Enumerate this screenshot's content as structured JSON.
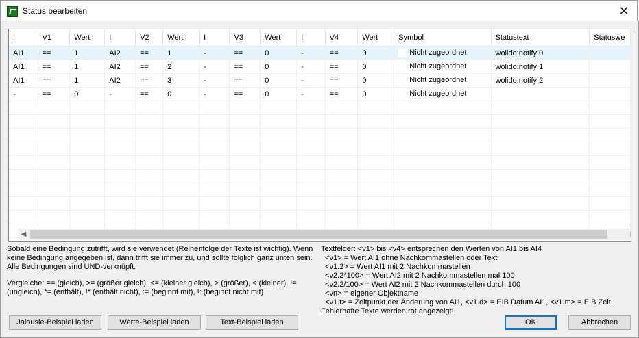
{
  "window": {
    "title": "Status bearbeiten",
    "close": "✕"
  },
  "grid": {
    "columns": [
      "I",
      "V1",
      "Wert",
      "I",
      "V2",
      "Wert",
      "I",
      "V3",
      "Wert",
      "I",
      "V4",
      "Wert",
      "Symbol",
      "Statustext",
      "Statuswe"
    ],
    "rows": [
      [
        "AI1",
        "==",
        "1",
        "AI2",
        "==",
        "1",
        "-",
        "==",
        "0",
        "-",
        "==",
        "0",
        "Nicht zugeordnet",
        "wolido:notify:0",
        ""
      ],
      [
        "AI1",
        "==",
        "1",
        "AI2",
        "==",
        "2",
        "-",
        "==",
        "0",
        "-",
        "==",
        "0",
        "Nicht zugeordnet",
        "wolido:notify:1",
        ""
      ],
      [
        "AI1",
        "==",
        "1",
        "AI2",
        "==",
        "3",
        "-",
        "==",
        "0",
        "-",
        "==",
        "0",
        "Nicht zugeordnet",
        "wolido:notify:2",
        ""
      ],
      [
        "-",
        "==",
        "0",
        "-",
        "==",
        "0",
        "-",
        "==",
        "0",
        "-",
        "==",
        "0",
        "Nicht zugeordnet",
        "",
        ""
      ]
    ],
    "selected_row": 0,
    "empty_rows": 10
  },
  "help_left": {
    "p1": "Sobald eine Bedingung zutrifft, wird sie verwendet (Reihenfolge der Texte ist wichtig). Wenn\nkeine Bedingung angegeben ist, dann trifft sie immer zu, und sollte folglich ganz unten sein.\nAlle Bedingungen sind UND-verknüpft.",
    "p2": "Vergleiche: == (gleich), >= (größer gleich), <= (kleiner gleich), > (größer), < (kleiner), !=\n(ungleich), *= (enthält), !* (enthält nicht), := (beginnt mit), !: (beginnt nicht mit)"
  },
  "help_right": {
    "text": "Textfelder: <v1> bis <v4> entsprechen den Werten von AI1 bis AI4\n  <v1> = Wert AI1 ohne Nachkommastellen oder Text\n  <v1.2> = Wert AI1 mit 2 Nachkommastellen\n  <v2.2*100> = Wert AI2 mit 2 Nachkommastellen mal 100\n  <v2.2/100> = Wert AI2 mit 2 Nachkommastellen durch 100\n  <vn> = eigener Objektname\n  <v1.t> = Zeitpunkt der Änderung von AI1, <v1.d> = EIB Datum AI1, <v1.m> = EIB Zeit\nFehlerhafte Texte werden rot angezeigt!"
  },
  "buttons": {
    "jalousie": "Jalousie-Beispiel laden",
    "werte": "Werte-Beispiel laden",
    "text": "Text-Beispiel laden",
    "ok": "OK",
    "cancel": "Abbrechen"
  }
}
